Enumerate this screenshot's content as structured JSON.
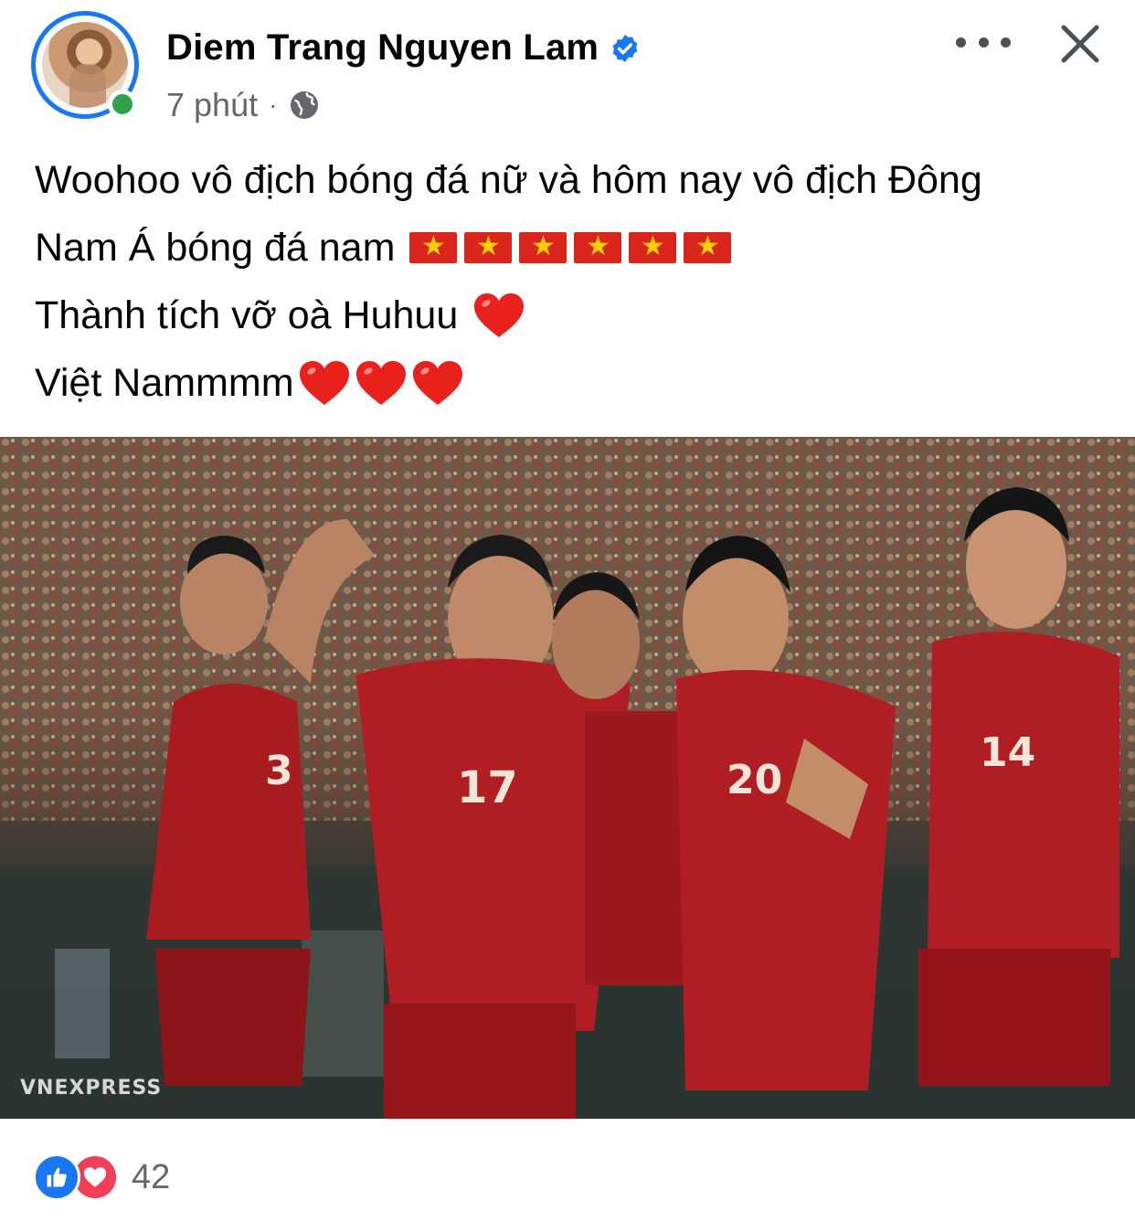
{
  "post": {
    "author_name": "Diem Trang Nguyen Lam",
    "time": "7 phút",
    "separator": "·",
    "lines": [
      "Woohoo vô địch bóng đá nữ và hôm nay vô địch Đông",
      "Nam Á bóng đá nam",
      "Thành tích vỡ oà Huhuu",
      "Việt Nammmm"
    ],
    "image_watermark": "VNEXPRESS"
  },
  "reactions": {
    "count": "42"
  },
  "icons": {
    "verified": "verified-badge-icon",
    "privacy": "globe-icon",
    "more": "more-options-icon",
    "close": "close-icon",
    "flag": "vietnam-flag-icon",
    "heart": "red-heart-icon",
    "like": "like-reaction-icon",
    "love": "love-reaction-icon"
  },
  "colors": {
    "brand_blue": "#1877f2",
    "online_green": "#31a24c",
    "flag_red": "#da251d",
    "flag_star": "#ffcd00",
    "love_red": "#f33e58",
    "meta_gray": "#65676b"
  }
}
